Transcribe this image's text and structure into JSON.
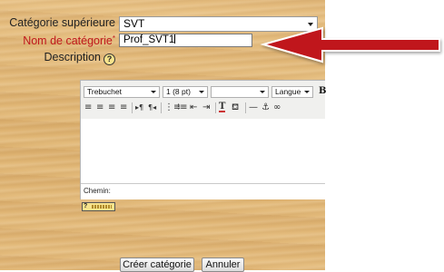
{
  "form": {
    "parent_label": "Catégorie supérieure",
    "parent_value": "SVT",
    "name_label": "Nom de catégorie",
    "name_required_mark": "*",
    "name_value": "Prof_SVT1",
    "description_label": "Description",
    "help_glyph": "?"
  },
  "editor": {
    "font_family": "Trebuchet",
    "font_size": "1 (8 pt)",
    "heading": "",
    "language": "Langue",
    "bold": "B",
    "path_label": "Chemin:",
    "help_glyph": "?"
  },
  "buttons": {
    "submit": "Créer catégorie",
    "cancel": "Annuler"
  },
  "colors": {
    "required_label": "#c0171c",
    "arrow_fill": "#c0151d",
    "wood": "#e3b97a"
  }
}
